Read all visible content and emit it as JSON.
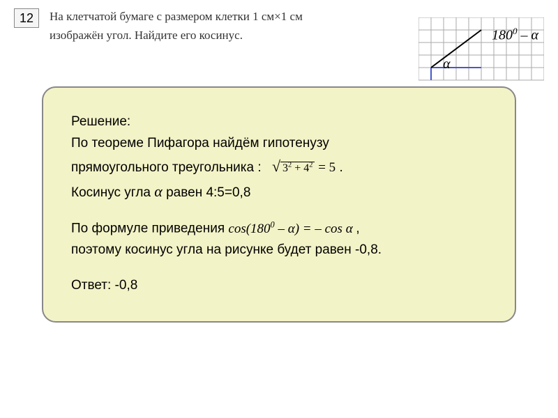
{
  "problem": {
    "number": "12",
    "text_line1": "На клетчатой бумаге с размером клетки 1 см×1 см",
    "text_line2": "изображён угол. Найдите его косинус."
  },
  "diagram": {
    "label_180": "180",
    "label_180_sup": "0",
    "label_minus": " – ",
    "label_alpha1": "α",
    "label_alpha2": "α"
  },
  "solution": {
    "title": "Решение:",
    "line1": "По теореме Пифагора найдём  гипотенузу",
    "line2_a": "прямоугольного треугольника :",
    "pythagoras_inner": "3",
    "pythagoras_sup1": "2",
    "pythagoras_plus": " + 4",
    "pythagoras_sup2": "2",
    "pythagoras_eq": " = 5",
    "line2_end": " .",
    "line3_a": "Косинус угла ",
    "line3_alpha": "α",
    "line3_b": "   равен 4:5=0,8",
    "line4_a": "По формуле приведения ",
    "reduction_cos": "cos",
    "reduction_paren1": "(180",
    "reduction_sup": "0",
    "reduction_minus": " – ",
    "reduction_alpha1": "α",
    "reduction_paren2": ") = – cos ",
    "reduction_alpha2": "α",
    "line4_end": " ,",
    "line5": "поэтому  косинус угла на рисунке будет равен -0,8.",
    "answer": "Ответ: -0,8"
  },
  "chart_data": {
    "type": "diagram",
    "description": "Right triangle on grid paper with legs 3 and 4 cells",
    "grid_size_cm": 1,
    "triangle_legs": [
      3,
      4
    ],
    "hypotenuse": 5,
    "angle_alpha_cosine": 0.8,
    "obtuse_angle": "180° - α",
    "obtuse_cosine": -0.8
  }
}
